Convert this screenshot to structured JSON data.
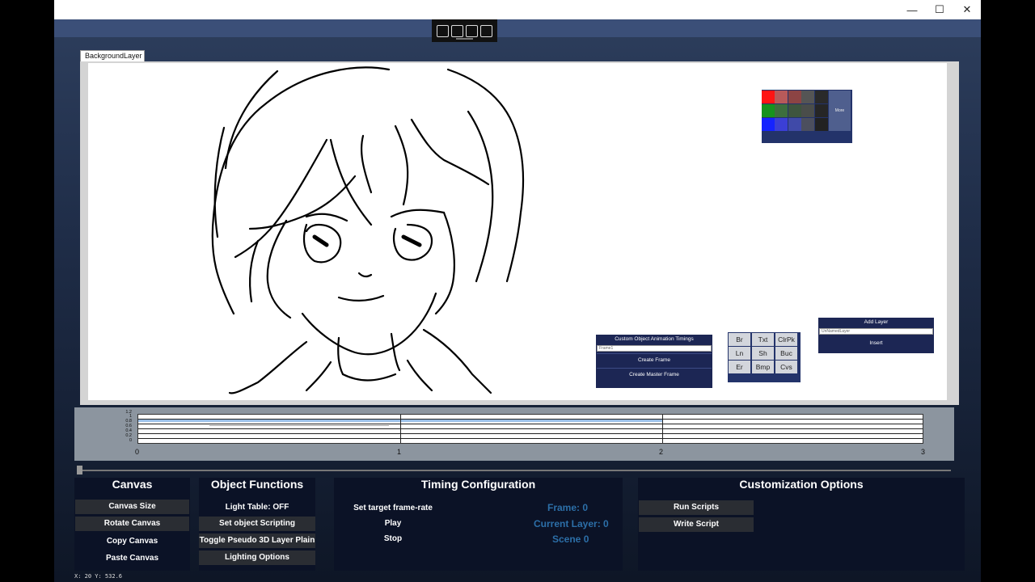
{
  "window": {
    "controls": {
      "minimize": "—",
      "maximize": "☐",
      "close": "✕"
    }
  },
  "dev_toolbar": {
    "icons": [
      "live-visual-tree-icon",
      "select-element-icon",
      "display-layout-adorners-icon",
      "track-focus-icon"
    ]
  },
  "canvas": {
    "layer_tab": "BackgroundLayer"
  },
  "palette": {
    "colors": [
      [
        "#ff1414",
        "#b85a5a",
        "#8c4444",
        "#555555",
        "#2a2a2a"
      ],
      [
        "#17921e",
        "#3d6e3d",
        "#3e553e",
        "#4a4d4a",
        "#262626"
      ],
      [
        "#1523ff",
        "#3b3fd6",
        "#404aa8",
        "#4c4f5e",
        "#222222"
      ]
    ],
    "more_label": "More"
  },
  "animation_panel": {
    "header": "Custom Object Animation Timings",
    "frame_input_value": "Frame1",
    "create_frame": "Create Frame",
    "create_master_frame": "Create Master Frame"
  },
  "tools": {
    "rows": [
      [
        "Br",
        "Txt",
        "ClrPk"
      ],
      [
        "Ln",
        "Sh",
        "Buc"
      ],
      [
        "Er",
        "Bmp",
        "Cvs"
      ]
    ]
  },
  "layer_panel": {
    "add_layer": "Add Layer",
    "layer_name_value": "UnNamedLayer",
    "insert": "Insert"
  },
  "timeline": {
    "y_ticks": [
      "1.2",
      "1",
      "0.8",
      "0.6",
      "0.4",
      "0.2",
      "0"
    ],
    "x_ticks": [
      "0",
      "1",
      "2",
      "3"
    ]
  },
  "panels": {
    "canvas": {
      "title": "Canvas",
      "buttons": [
        "Canvas Size",
        "Rotate Canvas",
        "Copy Canvas",
        "Paste Canvas"
      ]
    },
    "object_functions": {
      "title": "Object Functions",
      "buttons": [
        "Light Table: OFF",
        "Set object Scripting",
        "Toggle Pseudo 3D Layer Plain",
        "Lighting Options"
      ]
    },
    "timing": {
      "title": "Timing Configuration",
      "actions": [
        "Set target frame-rate",
        "Play",
        "Stop"
      ],
      "frame": "Frame: 0",
      "current_layer": "Current Layer: 0",
      "scene": "Scene 0"
    },
    "customization": {
      "title": "Customization Options",
      "buttons": [
        "Run Scripts",
        "Write Script"
      ]
    }
  },
  "status": {
    "coords": "X: 20 Y: 532.6"
  }
}
